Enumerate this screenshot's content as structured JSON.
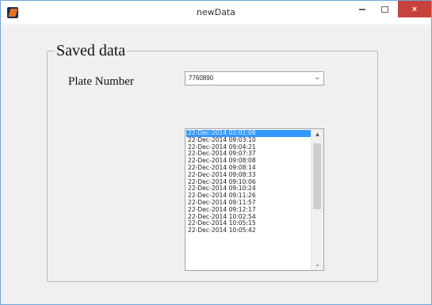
{
  "window": {
    "title": "newData",
    "minimize_glyph": "",
    "maximize_glyph": "",
    "close_glyph": "×"
  },
  "panel": {
    "title": "Saved data",
    "plate_label": "Plate Number",
    "plate_value": "7760890",
    "dropdown_glyph": "⌄"
  },
  "list": {
    "items": [
      "22-Dec-2014 02:01:06",
      "22-Dec-2014 09:03:10",
      "22-Dec-2014 09:04:21",
      "22-Dec-2014 09:07:37",
      "22-Dec-2014 09:08:08",
      "22-Dec-2014 09:08:14",
      "22-Dec-2014 09:08:33",
      "22-Dec-2014 09:10:06",
      "22-Dec-2014 09:10:24",
      "22-Dec-2014 09:11:26",
      "22-Dec-2014 09:11:57",
      "22-Dec-2014 09:12:17",
      "22-Dec-2014 10:02:54",
      "22-Dec-2014 10:05:15",
      "22-Dec-2014 10:05:42"
    ],
    "selected_index": 0,
    "scroll_up_glyph": "▲",
    "scroll_down_glyph": "⌄"
  },
  "icons": {
    "app": "matlab-icon",
    "minimize": "minimize-icon",
    "maximize": "maximize-icon",
    "close": "close-icon"
  },
  "colors": {
    "selection": "#3399ff",
    "close_button": "#c7423d",
    "window_border": "#6fa7d9"
  }
}
